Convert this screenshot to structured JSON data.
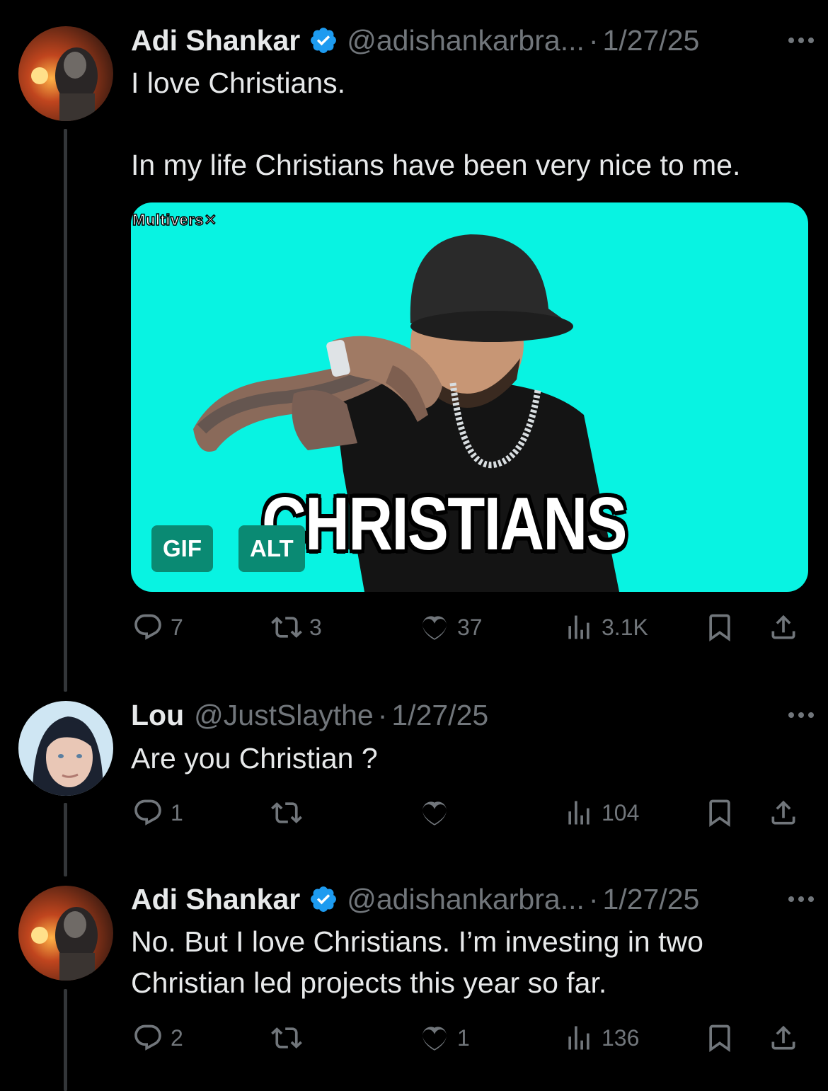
{
  "tweets": [
    {
      "name": "Adi Shankar",
      "verified": true,
      "handle": "@adishankarbra...",
      "date": "1/27/25",
      "text": "I love Christians.\n\nIn my life Christians have been very nice to me.",
      "media": {
        "watermark": "Multivers✕",
        "caption": "CHRISTIANS",
        "gif_badge": "GIF",
        "alt_badge": "ALT"
      },
      "stats": {
        "replies": "7",
        "reposts": "3",
        "likes": "37",
        "views": "3.1K"
      }
    },
    {
      "name": "Lou",
      "verified": false,
      "handle": "@JustSlaythe",
      "date": "1/27/25",
      "text": "Are you Christian ?",
      "stats": {
        "replies": "1",
        "reposts": "",
        "likes": "",
        "views": "104"
      }
    },
    {
      "name": "Adi Shankar",
      "verified": true,
      "handle": "@adishankarbra...",
      "date": "1/27/25",
      "text": "No. But I love Christians. I’m investing in two\nChristian led projects this year so far.",
      "stats": {
        "replies": "2",
        "reposts": "",
        "likes": "1",
        "views": "136"
      }
    }
  ],
  "separator": "·",
  "colors": {
    "background": "#000000",
    "text": "#e7e9ea",
    "muted": "#71767b",
    "verified": "#1d9bf0",
    "gif_bg": "#08f3e2"
  },
  "icons": [
    "verified-badge-icon",
    "more-icon",
    "reply-icon",
    "repost-icon",
    "like-icon",
    "views-icon",
    "bookmark-icon",
    "share-icon"
  ]
}
